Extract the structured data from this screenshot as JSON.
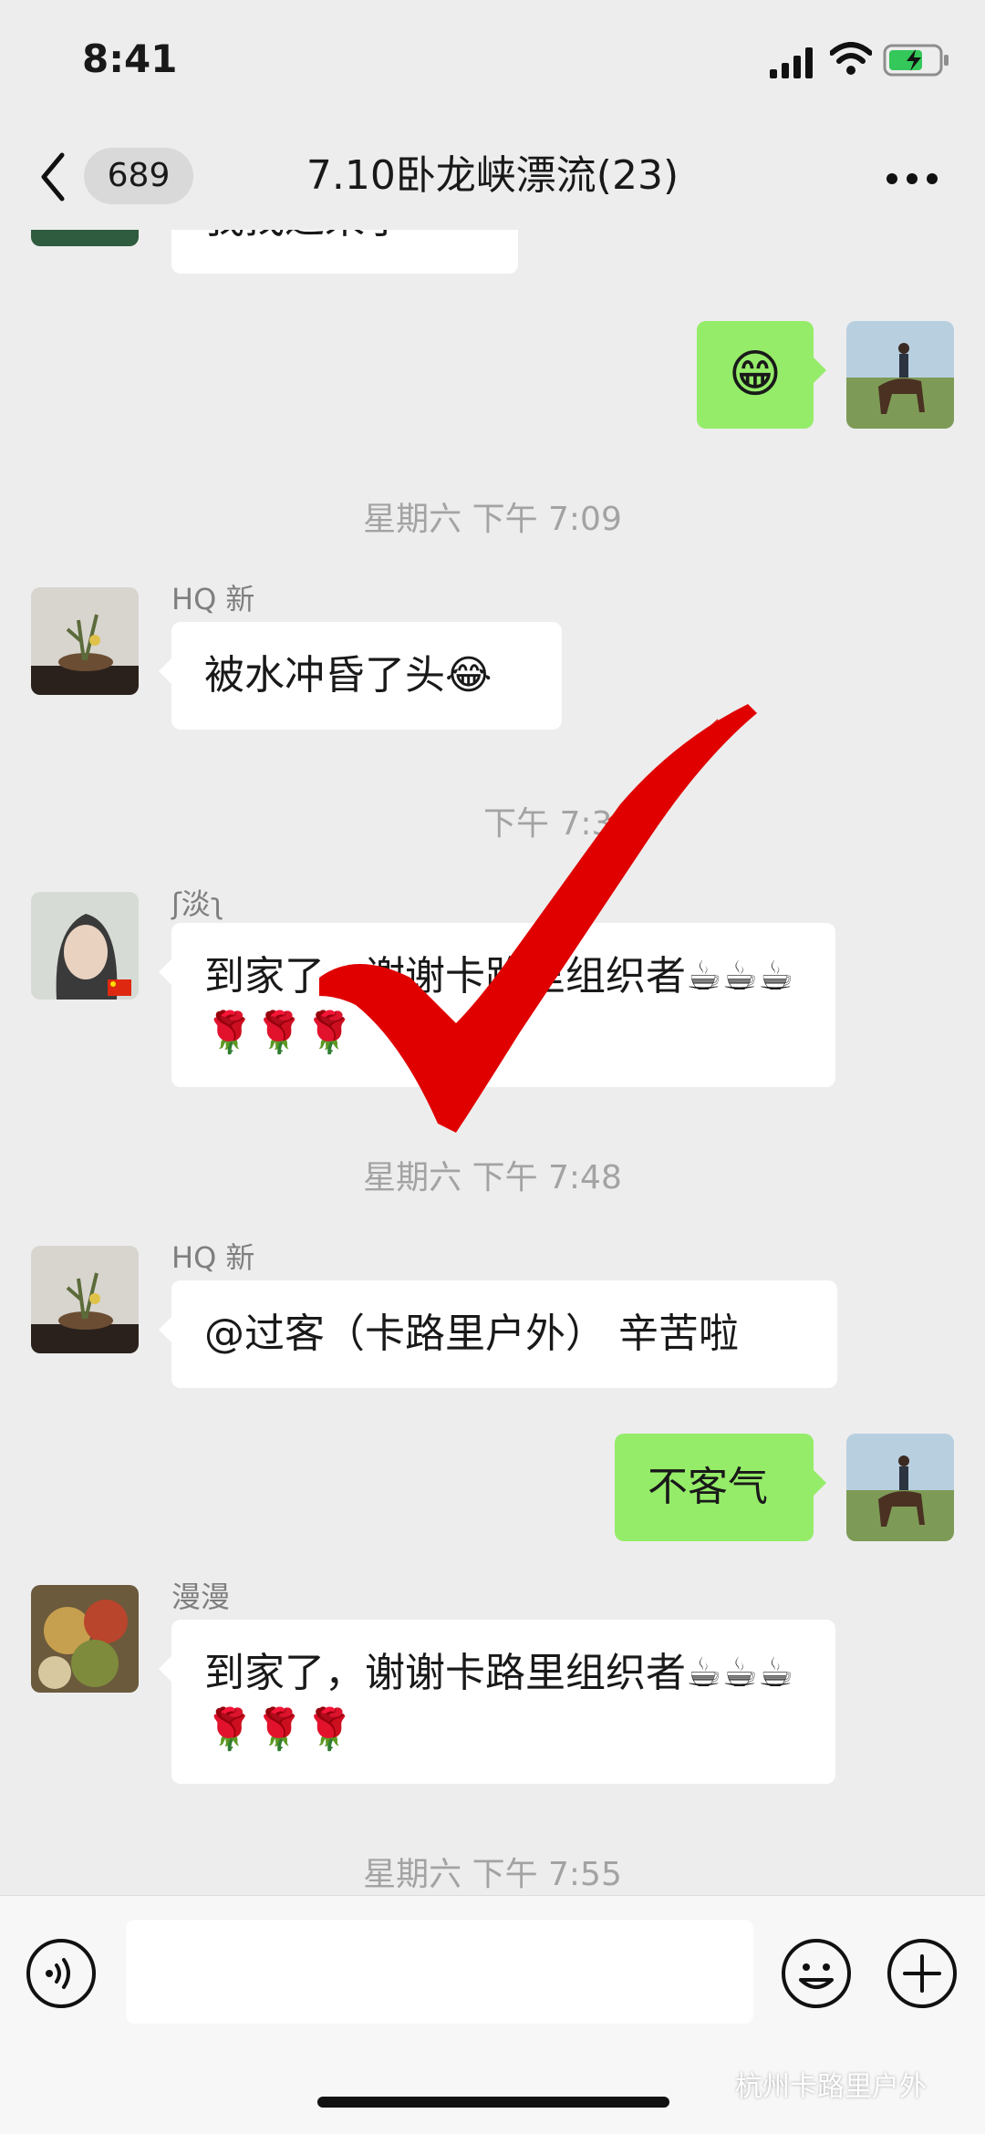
{
  "status_bar": {
    "time": "8:41"
  },
  "header": {
    "back_count": "689",
    "title": "7.10卧龙峡漂流(23)"
  },
  "messages": {
    "m1": {
      "text": "我找过来了"
    },
    "m2": {
      "emoji": "😁"
    },
    "t1": {
      "time": "星期六 下午 7:09"
    },
    "m3": {
      "sender": "HQ 新",
      "text": "被水冲昏了头😂"
    },
    "t2": {
      "time": "下午 7:31"
    },
    "m4": {
      "sender": "ʃ淡ʅ",
      "text": "到家了，谢谢卡路里组织者☕☕☕🌹🌹🌹"
    },
    "t3": {
      "time": "星期六 下午 7:48"
    },
    "m5": {
      "sender": "HQ 新",
      "text": "@过客（卡路里户外） 辛苦啦"
    },
    "m6": {
      "text": "不客气"
    },
    "m7": {
      "sender": "漫漫",
      "text": "到家了，谢谢卡路里组织者☕☕☕🌹🌹🌹"
    },
    "t4": {
      "time": "星期六 下午 7:55"
    }
  },
  "watermark": "杭州卡路里户外",
  "icons": [
    "back-icon",
    "more-icon",
    "voice-icon",
    "emoji-icon",
    "plus-icon",
    "signal-icon",
    "wifi-icon",
    "battery-icon"
  ],
  "colors": {
    "background": "#ededed",
    "outgoing_bubble": "#95ec69",
    "incoming_bubble": "#ffffff",
    "check_overlay": "#e00000"
  }
}
